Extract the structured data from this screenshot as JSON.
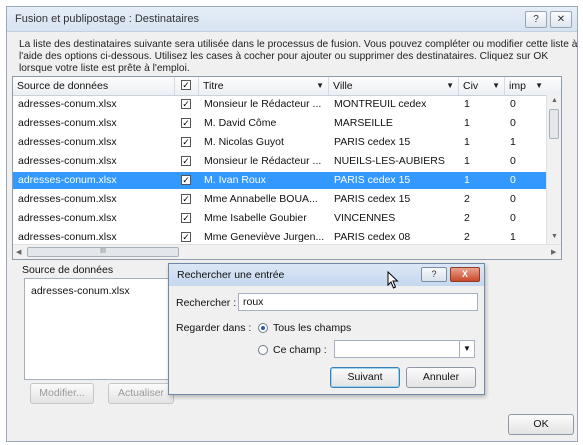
{
  "window": {
    "title": "Fusion et publipostage : Destinataires",
    "help_btn": "?",
    "close_btn": "✕",
    "description": "La liste des destinataires suivante sera utilisée dans le processus de fusion. Vous pouvez compléter ou modifier cette liste à l'aide des options ci-dessous. Utilisez les cases à cocher pour ajouter ou supprimer des destinataires. Cliquez sur OK lorsque votre liste est prête à l'emploi."
  },
  "table": {
    "columns": [
      "Source de données",
      "",
      "Titre",
      "Ville",
      "Civ",
      "imp"
    ],
    "rows": [
      {
        "source": "adresses-conum.xlsx",
        "checked": true,
        "titre": "Monsieur le Rédacteur ...",
        "ville": "MONTREUIL cedex",
        "civ": "1",
        "imp": "0"
      },
      {
        "source": "adresses-conum.xlsx",
        "checked": true,
        "titre": "M. David Côme",
        "ville": "MARSEILLE",
        "civ": "1",
        "imp": "0"
      },
      {
        "source": "adresses-conum.xlsx",
        "checked": true,
        "titre": "M. Nicolas Guyot",
        "ville": "PARIS cedex 15",
        "civ": "1",
        "imp": "1"
      },
      {
        "source": "adresses-conum.xlsx",
        "checked": true,
        "titre": "Monsieur le Rédacteur ...",
        "ville": "NUEILS-LES-AUBIERS",
        "civ": "1",
        "imp": "0"
      },
      {
        "source": "adresses-conum.xlsx",
        "checked": true,
        "titre": "M. Ivan Roux",
        "ville": "PARIS cedex 15",
        "civ": "1",
        "imp": "0",
        "selected": true
      },
      {
        "source": "adresses-conum.xlsx",
        "checked": true,
        "titre": "Mme Annabelle BOUA...",
        "ville": "PARIS cedex 15",
        "civ": "2",
        "imp": "0"
      },
      {
        "source": "adresses-conum.xlsx",
        "checked": true,
        "titre": "Mme Isabelle Goubier",
        "ville": "VINCENNES",
        "civ": "2",
        "imp": "0"
      },
      {
        "source": "adresses-conum.xlsx",
        "checked": true,
        "titre": "Mme Geneviève Jurgen...",
        "ville": "PARIS cedex 08",
        "civ": "2",
        "imp": "1"
      }
    ],
    "hscroll_thumb": "III"
  },
  "lower": {
    "source_label": "Source de données",
    "source_item": "adresses-conum.xlsx",
    "modifier": "Modifier...",
    "actualiser": "Actualiser",
    "ok": "OK"
  },
  "find": {
    "title": "Rechercher une entrée",
    "help_btn": "?",
    "close_btn": "X",
    "search_label": "Rechercher :",
    "search_value": "roux",
    "look_in_label": "Regarder dans :",
    "all_fields": "Tous les champs",
    "this_field": "Ce champ :",
    "next_button": "Suivant",
    "cancel_button": "Annuler"
  }
}
